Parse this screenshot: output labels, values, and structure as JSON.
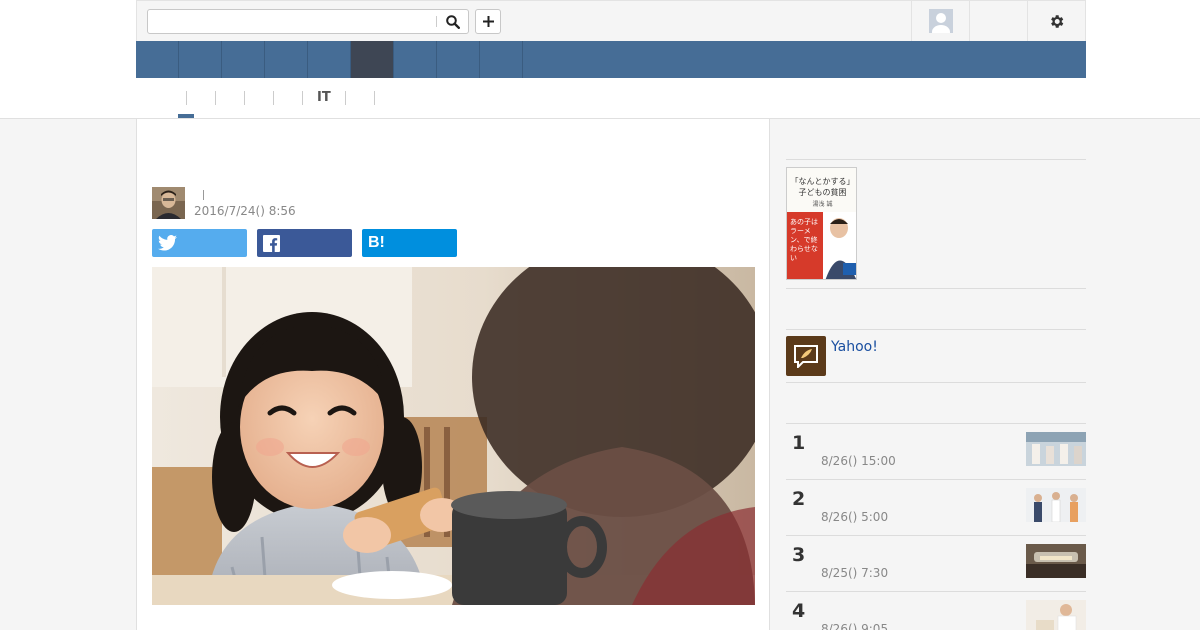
{
  "search": {
    "placeholder": ""
  },
  "header": {
    "search_icon": "search-icon",
    "add_icon": "plus-icon",
    "user_icon": "avatar-icon",
    "settings_icon": "gear-icon"
  },
  "navbar": {
    "item_count": 9,
    "active_index": 5,
    "color": "#466d96",
    "active_color": "#3e4654"
  },
  "subnav": {
    "items": [
      "",
      "",
      "",
      "",
      "",
      "IT",
      "",
      ""
    ],
    "active_index": 0
  },
  "article": {
    "title": "",
    "date": "2016/7/24() 8:56",
    "share": {
      "twitter_icon": "twitter-icon",
      "facebook_icon": "facebook-icon",
      "hatena_label": "B!"
    },
    "hero_image": "girl-eating-toast-photo"
  },
  "sidebar": {
    "book": {
      "title_line1": "「なんとかする」",
      "title_line2": "子どもの貧困",
      "author": "湯浅 誠",
      "cover_text": "あの子はラーメン、で終わらせない"
    },
    "yahoo_link": "Yahoo!",
    "ranking": [
      {
        "rank": "1",
        "date": "8/26() 15:00"
      },
      {
        "rank": "2",
        "date": "8/26() 5:00"
      },
      {
        "rank": "3",
        "date": "8/25() 7:30"
      },
      {
        "rank": "4",
        "date": "8/26() 9:05"
      }
    ]
  },
  "colors": {
    "twitter": "#55acee",
    "facebook": "#3b5998",
    "hatena": "#008fde"
  }
}
